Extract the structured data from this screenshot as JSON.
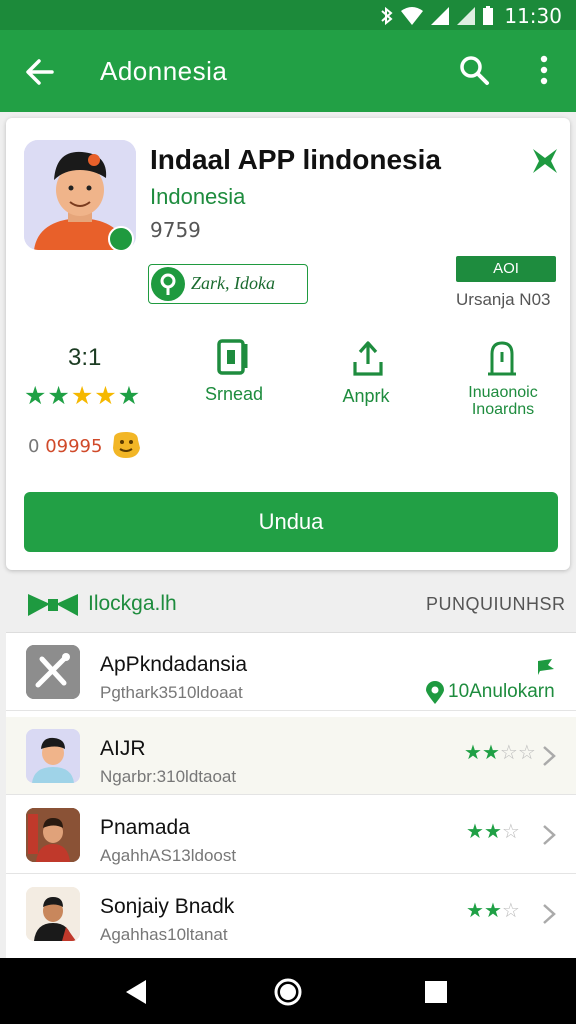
{
  "status_bar": {
    "time": "11:30"
  },
  "app_bar": {
    "title": "Adonnesia"
  },
  "app": {
    "name": "Indaal APP lindonesia",
    "developer": "Indonesia",
    "number": "9759",
    "sponsor_label": "Zark, Idoka",
    "rating_badge": "AOI",
    "rating_note": "Ursanja N03"
  },
  "stats": {
    "rating_value": "3:1",
    "stars_filled": 5,
    "size_label": "Srnead",
    "downloads_label": "Anprk",
    "age_label_line1": "Inuaonoic",
    "age_label_line2": "Inoardns",
    "review_count_prefix": "0",
    "review_count": "09995"
  },
  "install_button": {
    "label": "Undua"
  },
  "section": {
    "title": "Ilockga.lh",
    "link": "PUNQUIUNHSR"
  },
  "list_items": [
    {
      "title": "ApPkndadansia",
      "subtitle": "Pgthark3510ldoaat",
      "meta": "10Anulokarn",
      "stars": 0
    },
    {
      "title": "AIJR",
      "subtitle": "Ngarbr:310ldtaoat",
      "stars": 2,
      "stars_max": 5
    },
    {
      "title": "Pnamada",
      "subtitle": "AgahhAS13ldoost",
      "stars": 2,
      "stars_max": 3
    },
    {
      "title": "Sonjaiy Bnadk",
      "subtitle": "Agahhas10ltanat",
      "stars": 2,
      "stars_max": 3
    }
  ],
  "colors": {
    "primary": "#22a045",
    "primary_dark": "#1c8a3a",
    "star_green": "#1fa045",
    "star_gold": "#f5b800",
    "review_red": "#d04a2a"
  },
  "icons": {
    "back": "arrow-left-icon",
    "search": "search-icon",
    "more": "more-vert-icon",
    "bookmark": "bookmark-icon",
    "size": "phone-icon",
    "downloads": "download-icon",
    "age": "age-rating-icon"
  }
}
